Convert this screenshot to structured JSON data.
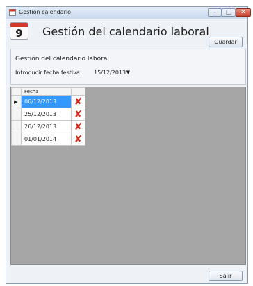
{
  "window": {
    "title": "Gestión calendario",
    "icon_name": "calendar-icon",
    "controls": [
      "minimize",
      "maximize",
      "close"
    ]
  },
  "header": {
    "calendar_number": "9",
    "title": "Gestión del calendario laboral"
  },
  "form": {
    "group_title": "Gestión del calendario laboral",
    "date_label": "Introducir fecha festiva:",
    "date_value": "15/12/2013",
    "save_label": "Guardar"
  },
  "grid": {
    "column_header": "Fecha",
    "rows": [
      {
        "fecha": "06/12/2013",
        "selected": true
      },
      {
        "fecha": "25/12/2013",
        "selected": false
      },
      {
        "fecha": "26/12/2013",
        "selected": false
      },
      {
        "fecha": "01/01/2014",
        "selected": false
      }
    ],
    "delete_icon": "delete-x-icon",
    "selection_color": "#3399ff"
  },
  "footer": {
    "exit_label": "Salir"
  }
}
